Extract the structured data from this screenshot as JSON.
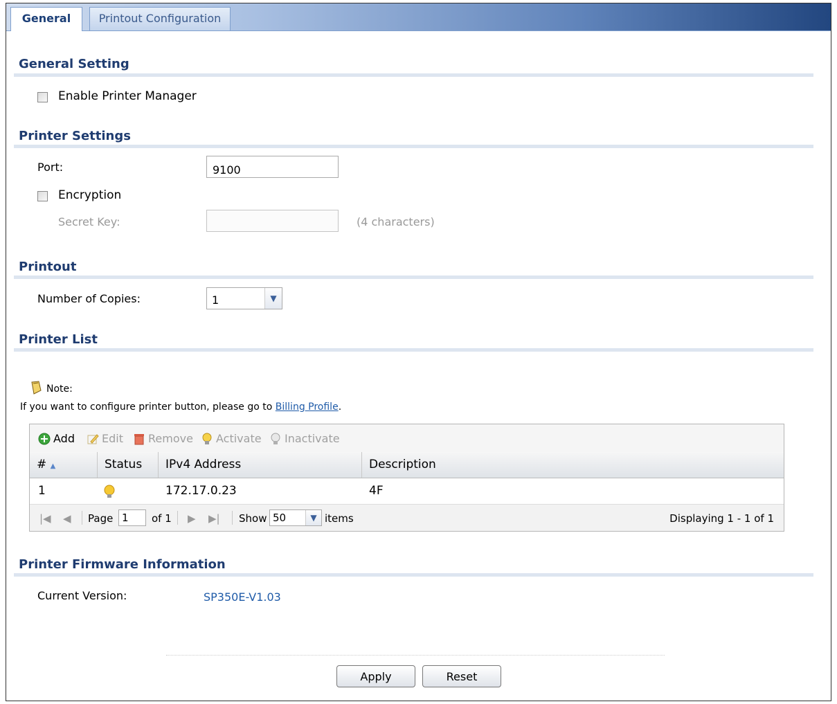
{
  "tabs": [
    {
      "label": "General",
      "active": true
    },
    {
      "label": "Printout Configuration",
      "active": false
    }
  ],
  "general_setting": {
    "title": "General Setting",
    "enable_printer_manager_label": "Enable Printer Manager",
    "enable_printer_manager_checked": false
  },
  "printer_settings": {
    "title": "Printer Settings",
    "port_label": "Port:",
    "port_value": "9100",
    "encryption_label": "Encryption",
    "encryption_checked": false,
    "secret_key_label": "Secret Key:",
    "secret_key_value": "",
    "secret_key_hint": "(4 characters)"
  },
  "printout": {
    "title": "Printout",
    "copies_label": "Number of Copies:",
    "copies_value": "1"
  },
  "printer_list": {
    "title": "Printer List",
    "note_title": "Note:",
    "note_text_prefix": "If you want to configure printer button, please go to",
    "note_link": "Billing Profile",
    "note_text_suffix": ".",
    "toolbar": {
      "add": "Add",
      "edit": "Edit",
      "remove": "Remove",
      "activate": "Activate",
      "inactivate": "Inactivate"
    },
    "columns": [
      "#",
      "Status",
      "IPv4 Address",
      "Description"
    ],
    "rows": [
      {
        "index": "1",
        "status": "active",
        "ipv4": "172.17.0.23",
        "description": "4F"
      }
    ],
    "pager": {
      "page_label": "Page",
      "page_value": "1",
      "of_label": "of 1",
      "show_label": "Show",
      "show_value": "50",
      "items_label": "items",
      "displaying": "Displaying 1 - 1 of 1"
    }
  },
  "firmware": {
    "title": "Printer Firmware Information",
    "current_version_label": "Current Version:",
    "current_version_value": "SP350E-V1.03"
  },
  "buttons": {
    "apply": "Apply",
    "reset": "Reset"
  },
  "colors": {
    "section_title": "#1f3c70",
    "link": "#1f5ba8",
    "tabbar_dark": "#22467f"
  }
}
